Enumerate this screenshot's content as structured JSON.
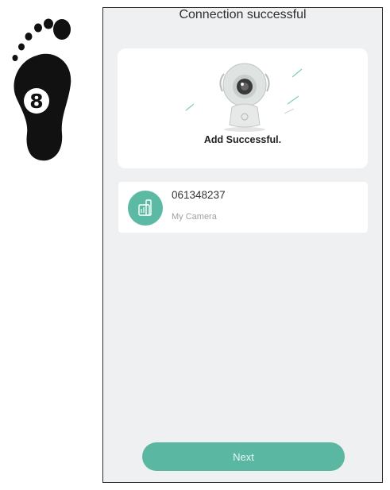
{
  "step": {
    "number": "8"
  },
  "screen": {
    "title": "Connection successful",
    "success_message": "Add Successful.",
    "device": {
      "id": "061348237",
      "name": "My Camera",
      "icon": "camera-device-icon"
    },
    "next_button": "Next"
  },
  "colors": {
    "accent": "#5ab7a2",
    "background": "#eef0f2",
    "card": "#ffffff",
    "footprint": "#111111"
  }
}
